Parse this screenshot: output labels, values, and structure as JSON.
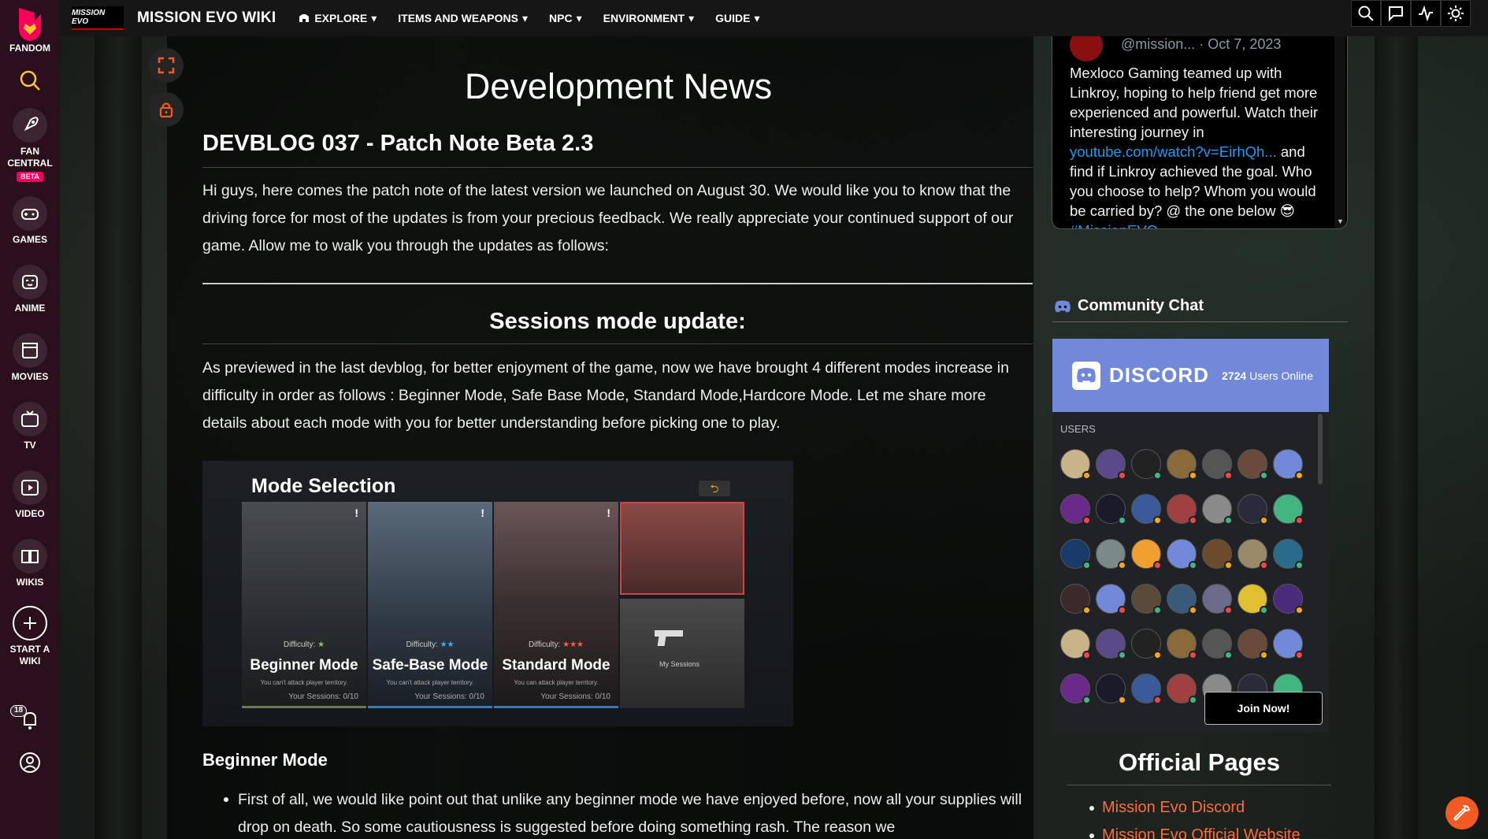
{
  "rail": {
    "fandom_label": "FANDOM",
    "items": [
      {
        "label": "FAN\nCENTRAL",
        "line1": "FAN",
        "line2": "CENTRAL",
        "badge": "BETA"
      },
      {
        "label": "GAMES"
      },
      {
        "label": "ANIME"
      },
      {
        "label": "MOVIES"
      },
      {
        "label": "TV"
      },
      {
        "label": "VIDEO"
      },
      {
        "label": "WIKIS"
      },
      {
        "line1": "START A",
        "line2": "WIKI"
      }
    ],
    "notification_count": "18"
  },
  "topbar": {
    "logo_text": "MISSION EVO",
    "wiki_name": "MISSION EVO WIKI",
    "nav": [
      "EXPLORE",
      "ITEMS AND WEAPONS",
      "NPC",
      "ENVIRONMENT",
      "GUIDE"
    ]
  },
  "article": {
    "page_title": "Development News",
    "heading": "DEVBLOG 037 - Patch Note Beta 2.3",
    "intro": "Hi guys, here comes the patch note of the latest version we launched on August 30. We would like you to know that the driving force for most of the updates is from your precious feedback. We really appreciate your continued support of our game. Allow me to walk you through the updates as follows:",
    "section_heading": "Sessions mode update:",
    "section_text": "As previewed in the last devblog, for better enjoyment of the game, now we have brought 4 different modes increase in difficulty in order as follows : Beginner Mode, Safe Base Mode, Standard Mode,Hardcore Mode. Let me share more details about each mode with you for better understanding before picking one to play.",
    "image": {
      "title": "Mode Selection",
      "back_glyph": "⮌",
      "difficulty_label": "Difficulty:",
      "sessions_label": "Your Sessions:",
      "modes": [
        {
          "name": "Beginner Mode",
          "note": "You can't attack player territory.",
          "sessions": "0/10",
          "stars": "★"
        },
        {
          "name": "Safe-Base Mode",
          "note": "You can't attack player territory.",
          "sessions": "0/10",
          "stars": "★★"
        },
        {
          "name": "Standard Mode",
          "note": "You can attack player territory.",
          "sessions": "0/10",
          "stars": "★★★"
        }
      ],
      "my_sessions_label": "My Sessions"
    },
    "subheading": "Beginner Mode",
    "bullet": "First of all, we would like point out that unlike any beginner mode we have enjoyed before, now all your supplies will drop on death. So some cautiousness is suggested before doing something rash. The reason we"
  },
  "tweet": {
    "handle": "@mission...",
    "date": "· Oct 7, 2023",
    "text1": "Mexloco Gaming teamed up with Linkroy, hoping to help friend get more experienced and powerful. Watch their interesting journey in ",
    "link": "youtube.com/watch?v=EirhQh...",
    "text2": " and find if Linkroy achieved the goal. Who you choose to help? Whom you would be carried by? @ the one below 😎 ",
    "hashtag": "#MissionEVO"
  },
  "community_chat": {
    "title": "Community Chat",
    "discord_label": "DISCORD",
    "online_count": "2724",
    "online_suffix": " Users Online",
    "users_label": "USERS",
    "join_label": "Join Now!"
  },
  "official_pages": {
    "title": "Official Pages",
    "links": [
      "Mission Evo Discord",
      "Mission Evo Official Website"
    ]
  },
  "colors": {
    "rail_bg": "#2a101c",
    "discord_header": "#7289da",
    "link_orange": "#ff6b3d",
    "tweet_link": "#1d9bf0"
  }
}
